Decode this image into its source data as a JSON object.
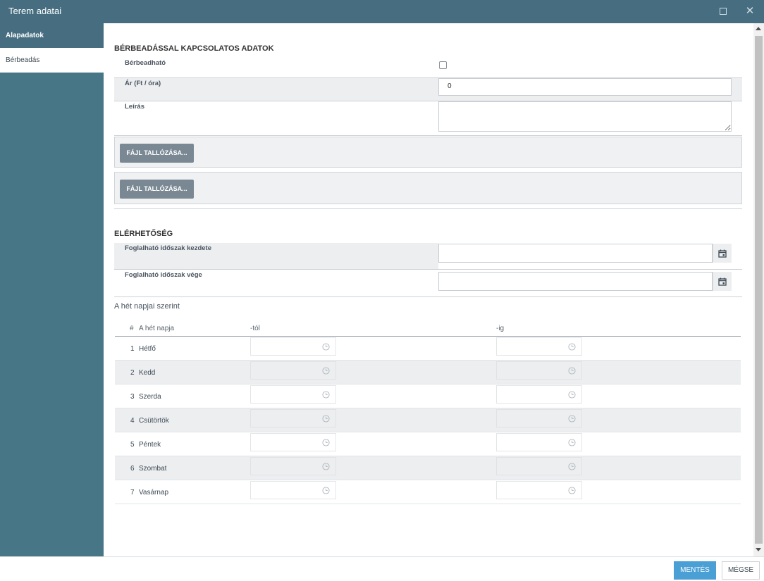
{
  "window": {
    "title": "Terem adatai"
  },
  "sidebar": {
    "items": [
      {
        "label": "Alapadatok"
      },
      {
        "label": "Bérbeadás"
      }
    ]
  },
  "rental": {
    "section_title": "BÉRBEADÁSSAL KAPCSOLATOS ADATOK",
    "rentable_label": "Bérbeadható",
    "price_label": "Ár (Ft / óra)",
    "price_value": "0",
    "description_label": "Leírás",
    "description_value": "",
    "file_button_1": "FÁJL TALLÓZÁSA...",
    "file_button_2": "FÁJL TALLÓZÁSA..."
  },
  "availability": {
    "section_title": "ELÉRHETŐSÉG",
    "start_label": "Foglalható időszak kezdete",
    "start_value": "",
    "end_label": "Foglalható időszak vége",
    "end_value": "",
    "weekdays_title": "A hét napjai szerint",
    "columns": {
      "num": "#",
      "day": "A hét napja",
      "from": "-tól",
      "to": "-ig"
    },
    "days": [
      {
        "num": "1",
        "name": "Hétfő"
      },
      {
        "num": "2",
        "name": "Kedd"
      },
      {
        "num": "3",
        "name": "Szerda"
      },
      {
        "num": "4",
        "name": "Csütörtök"
      },
      {
        "num": "5",
        "name": "Péntek"
      },
      {
        "num": "6",
        "name": "Szombat"
      },
      {
        "num": "7",
        "name": "Vasárnap"
      }
    ]
  },
  "footer": {
    "save_label": "MENTÉS",
    "cancel_label": "MÉGSE"
  },
  "colors": {
    "header": "#466e80",
    "sidebar": "#477786",
    "primary": "#4a9fd5",
    "file_button": "#7a8894"
  },
  "icons": {
    "maximize": "maximize-icon",
    "close": "close-icon",
    "calendar": "calendar-icon",
    "clock": "clock-icon"
  }
}
